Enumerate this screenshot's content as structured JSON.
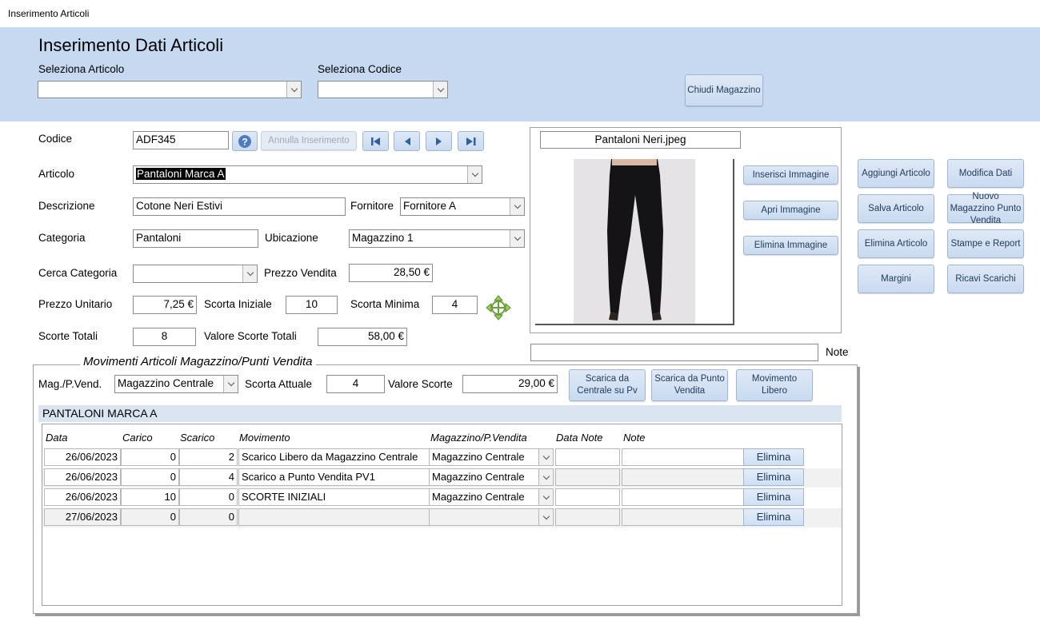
{
  "window": {
    "title": "Inserimento Articoli"
  },
  "header": {
    "title": "Inserimento Dati Articoli",
    "select_articolo_label": "Seleziona Articolo",
    "select_articolo_value": "",
    "select_codice_label": "Seleziona Codice",
    "select_codice_value": "",
    "close_button": "Chiudi Magazzino"
  },
  "form": {
    "codice_label": "Codice",
    "codice_value": "ADF345",
    "annulla_label": "Annulla Inserimento",
    "articolo_label": "Articolo",
    "articolo_value": "Pantaloni Marca A",
    "descrizione_label": "Descrizione",
    "descrizione_value": "Cotone Neri Estivi",
    "fornitore_label": "Fornitore",
    "fornitore_value": "Fornitore A",
    "categoria_label": "Categoria",
    "categoria_value": "Pantaloni",
    "ubicazione_label": "Ubicazione",
    "ubicazione_value": "Magazzino 1",
    "cerca_categoria_label": "Cerca Categoria",
    "cerca_categoria_value": "",
    "prezzo_vendita_label": "Prezzo Vendita",
    "prezzo_vendita_value": "28,50 €",
    "prezzo_unitario_label": "Prezzo Unitario",
    "prezzo_unitario_value": "7,25 €",
    "scorta_iniziale_label": "Scorta Iniziale",
    "scorta_iniziale_value": "10",
    "scorta_minima_label": "Scorta Minima",
    "scorta_minima_value": "4",
    "scorte_totali_label": "Scorte Totali",
    "scorte_totali_value": "8",
    "valore_scorte_totali_label": "Valore Scorte Totali",
    "valore_scorte_totali_value": "58,00 €"
  },
  "image": {
    "filename": "Pantaloni Neri.jpeg",
    "inserisci": "Inserisci Immagine",
    "apri": "Apri Immagine",
    "elimina": "Elimina Immagine",
    "note_label": "Note",
    "note_value": ""
  },
  "actions": {
    "aggiungi": "Aggiungi Articolo",
    "modifica": "Modifica Dati",
    "salva": "Salva Articolo",
    "nuovo_magazzino": "Nuovo Magazzino Punto Vendita",
    "elimina": "Elimina Articolo",
    "stampe": "Stampe e Report",
    "margini": "Margini",
    "ricavi": "Ricavi Scarichi"
  },
  "movimenti": {
    "title": "Movimenti Articoli Magazzino/Punti Vendita",
    "mag_label": "Mag./P.Vend.",
    "mag_value": "Magazzino Centrale",
    "scorta_attuale_label": "Scorta Attuale",
    "scorta_attuale_value": "4",
    "valore_scorte_label": "Valore Scorte",
    "valore_scorte_value": "29,00 €",
    "btn_scarica_centrale": "Scarica da Centrale su Pv",
    "btn_scarica_pv": "Scarica da Punto Vendita",
    "btn_movimento_libero": "Movimento Libero",
    "article_banner": "PANTALONI MARCA A",
    "columns": [
      "Data",
      "Carico",
      "Scarico",
      "Movimento",
      "Magazzino/P.Vendita",
      "Data Note",
      "Note"
    ],
    "rows": [
      {
        "data": "26/06/2023",
        "carico": "0",
        "scarico": "2",
        "movimento": "Scarico Libero da Magazzino Centrale",
        "magazzino": "Magazzino Centrale",
        "data_note": "",
        "note": "",
        "action": "Elimina"
      },
      {
        "data": "26/06/2023",
        "carico": "0",
        "scarico": "4",
        "movimento": "Scarico a Punto Vendita PV1",
        "magazzino": "Magazzino Centrale",
        "data_note": "",
        "note": "",
        "action": "Elimina"
      },
      {
        "data": "26/06/2023",
        "carico": "10",
        "scarico": "0",
        "movimento": "SCORTE INIZIALI",
        "magazzino": "Magazzino Centrale",
        "data_note": "",
        "note": "",
        "action": "Elimina"
      },
      {
        "data": "27/06/2023",
        "carico": "0",
        "scarico": "0",
        "movimento": "",
        "magazzino": "",
        "data_note": "",
        "note": "",
        "action": "Elimina"
      }
    ]
  },
  "colors": {
    "header_bg": "#c6d9f1",
    "button_bg": "#c9daf0",
    "selection": "#000000"
  }
}
